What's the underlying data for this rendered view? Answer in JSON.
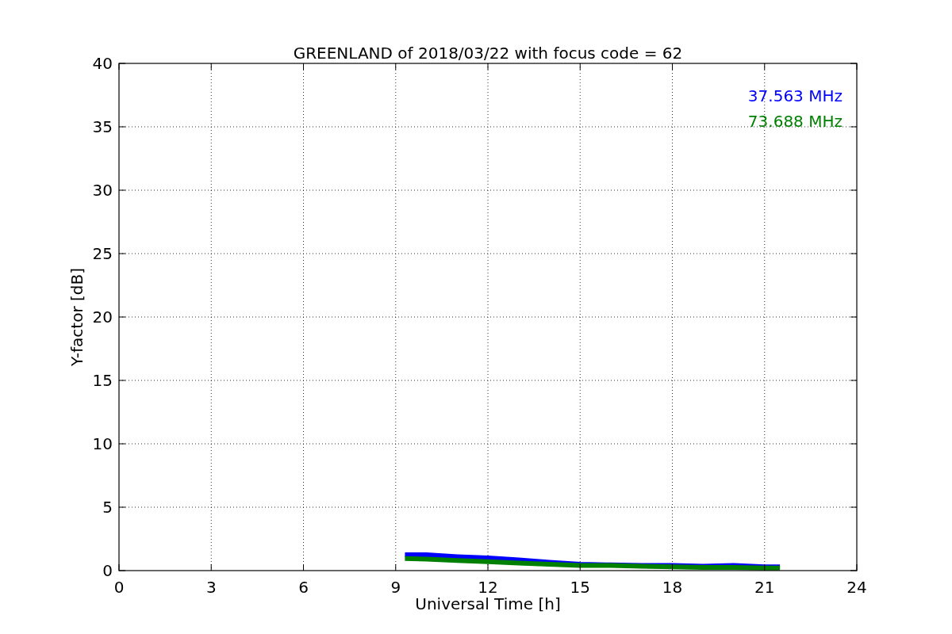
{
  "chart_data": {
    "type": "line",
    "title": "GREENLAND of 2018/03/22 with focus code = 62",
    "xlabel": "Universal Time [h]",
    "ylabel": "Y-factor [dB]",
    "x": [
      9.3,
      10,
      11,
      12,
      13,
      14,
      15,
      16,
      17,
      18,
      19,
      20,
      21,
      21.5
    ],
    "series": [
      {
        "name": "37.563 MHz",
        "color": "#0000ff",
        "values": [
          1.25,
          1.25,
          1.1,
          1.0,
          0.85,
          0.65,
          0.5,
          0.45,
          0.4,
          0.4,
          0.35,
          0.4,
          0.3,
          0.3
        ]
      },
      {
        "name": "73.688 MHz",
        "color": "#008000",
        "values": [
          0.95,
          0.9,
          0.8,
          0.7,
          0.6,
          0.5,
          0.4,
          0.4,
          0.35,
          0.3,
          0.25,
          0.25,
          0.2,
          0.2
        ]
      }
    ],
    "xlim": [
      0,
      24
    ],
    "ylim": [
      0,
      40
    ],
    "xticks": [
      0,
      3,
      6,
      9,
      12,
      15,
      18,
      21,
      24
    ],
    "yticks": [
      0,
      5,
      10,
      15,
      20,
      25,
      30,
      35,
      40
    ],
    "grid": true
  }
}
